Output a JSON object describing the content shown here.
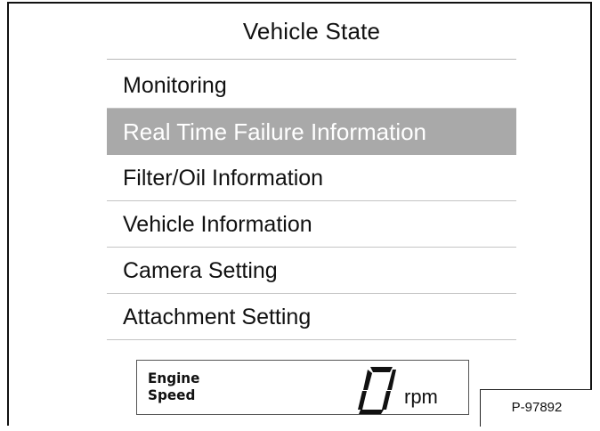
{
  "screen": {
    "title": "Vehicle State"
  },
  "menu": {
    "items": [
      {
        "label": "Monitoring",
        "selected": false
      },
      {
        "label": "Real Time Failure Information",
        "selected": true
      },
      {
        "label": "Filter/Oil Information",
        "selected": false
      },
      {
        "label": "Vehicle Information",
        "selected": false
      },
      {
        "label": "Camera Setting",
        "selected": false
      },
      {
        "label": "Attachment Setting",
        "selected": false
      }
    ]
  },
  "engine_speed": {
    "label_line1": "Engine",
    "label_line2": "Speed",
    "value": "0",
    "unit": "rpm"
  },
  "figure": {
    "reference_code": "P-97892"
  },
  "colors": {
    "selected_row_background": "#a9a9a9",
    "selected_row_text": "#ffffff",
    "text": "#111111",
    "divider": "#c4c4c4"
  }
}
